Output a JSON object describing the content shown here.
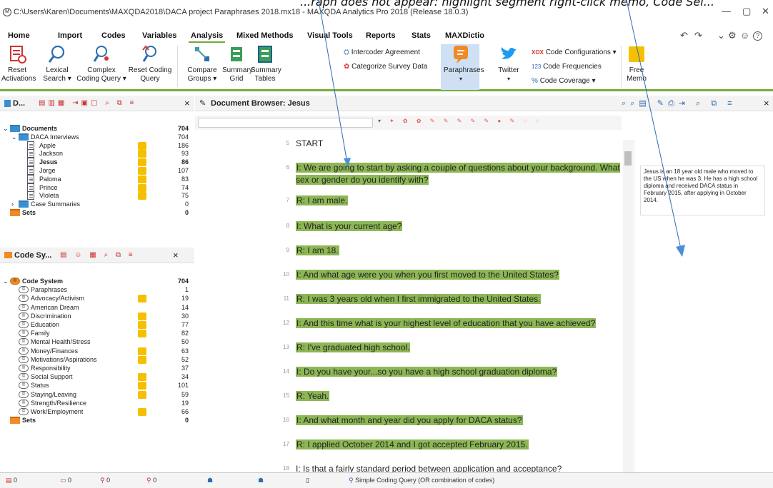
{
  "caption": "...raph does not appear: highlight segment right-click memo, Code Sel...",
  "window": {
    "logo": "M",
    "title": "C:\\Users\\Karen\\Documents\\MAXQDA2018\\DACA project Paraphrases 2018.mx18 - MAXQDA Analytics Pro 2018  (Release 18.0.3)",
    "minimize": "—",
    "maximize": "▢",
    "close": "✕"
  },
  "menu": [
    "Home",
    "Import",
    "Codes",
    "Variables",
    "Analysis",
    "Mixed Methods",
    "Visual Tools",
    "Reports",
    "Stats",
    "MAXDictio"
  ],
  "menu_right": {
    "undo": "↶",
    "redo": "↷",
    "chevron": "⌄",
    "gear": "⚙",
    "smile": "☺",
    "help": "?"
  },
  "ribbon": {
    "reset_activations": "Reset Activations",
    "lexical_search": "Lexical Search ▾",
    "complex_coding": "Complex Coding Query ▾",
    "reset_coding": "Reset Coding Query",
    "compare_groups": "Compare Groups ▾",
    "summary_grid": "Summary Grid",
    "summary_tables": "Summary Tables",
    "intercoder": "Intercoder Agreement",
    "categorize": "Categorize Survey Data",
    "paraphrases": "Paraphrases",
    "twitter": "Twitter",
    "code_configurations": "Code Configurations ▾",
    "code_frequencies": "Code Frequencies",
    "code_coverage": "Code Coverage ▾",
    "free_memo": "Free Memo"
  },
  "documents": {
    "panel_title": "D...",
    "items": [
      {
        "label": "Documents",
        "count": "704",
        "bold": true,
        "level": 0
      },
      {
        "label": "DACA Interviews",
        "count": "704",
        "bold": false,
        "level": 1
      },
      {
        "label": "Apple",
        "count": "186",
        "bold": false,
        "level": 2,
        "tag": true
      },
      {
        "label": "Jackson",
        "count": "93",
        "bold": false,
        "level": 2,
        "tag": true
      },
      {
        "label": "Jesus",
        "count": "86",
        "bold": true,
        "level": 2,
        "tag": true
      },
      {
        "label": "Jorge",
        "count": "107",
        "bold": false,
        "level": 2,
        "tag": true
      },
      {
        "label": "Paloma",
        "count": "83",
        "bold": false,
        "level": 2,
        "tag": true
      },
      {
        "label": "Prince",
        "count": "74",
        "bold": false,
        "level": 2,
        "tag": true
      },
      {
        "label": "Violeta",
        "count": "75",
        "bold": false,
        "level": 2,
        "tag": true
      },
      {
        "label": "Case Summaries",
        "count": "0",
        "bold": false,
        "level": 1
      },
      {
        "label": "Sets",
        "count": "0",
        "bold": true,
        "level": 0
      }
    ]
  },
  "codes": {
    "panel_title": "Code Sy...",
    "items": [
      {
        "label": "Code System",
        "count": "704",
        "bold": true,
        "level": 0
      },
      {
        "label": "Paraphrases",
        "count": "1",
        "level": 1
      },
      {
        "label": "Advocacy/Activism",
        "count": "19",
        "level": 1,
        "tag": true
      },
      {
        "label": "American Dream",
        "count": "14",
        "level": 1
      },
      {
        "label": "Discrimination",
        "count": "30",
        "level": 1,
        "tag": true
      },
      {
        "label": "Education",
        "count": "77",
        "level": 1,
        "tag": true
      },
      {
        "label": "Family",
        "count": "82",
        "level": 1,
        "tag": true
      },
      {
        "label": "Mental Health/Stress",
        "count": "50",
        "level": 1
      },
      {
        "label": "Money/Finances",
        "count": "63",
        "level": 1,
        "tag": true
      },
      {
        "label": "Motivations/Aspirations",
        "count": "52",
        "level": 1,
        "tag": true
      },
      {
        "label": "Responsibility",
        "count": "37",
        "level": 1
      },
      {
        "label": "Social Support",
        "count": "34",
        "level": 1,
        "tag": true
      },
      {
        "label": "Status",
        "count": "101",
        "level": 1,
        "tag": true
      },
      {
        "label": "Staying/Leaving",
        "count": "59",
        "level": 1,
        "tag": true
      },
      {
        "label": "Strength/Resilience",
        "count": "19",
        "level": 1
      },
      {
        "label": "Work/Employment",
        "count": "66",
        "level": 1,
        "tag": true
      },
      {
        "label": "Sets",
        "count": "0",
        "bold": true,
        "level": 0
      }
    ]
  },
  "browser": {
    "title": "Document Browser: Jesus",
    "paragraphs": [
      {
        "n": "5",
        "text": "START",
        "hl": false
      },
      {
        "n": "6",
        "text": "I: We are going to start by asking a couple of questions about your background. What sex or gender do you identify with?",
        "hl": true
      },
      {
        "n": "7",
        "text": "R: I am male.",
        "hl": true
      },
      {
        "n": "8",
        "text": "I: What is your current age?",
        "hl": true
      },
      {
        "n": "9",
        "text": "R: I am 18.",
        "hl": true
      },
      {
        "n": "10",
        "text": "I: And what age were you when you first moved to the United States?",
        "hl": true
      },
      {
        "n": "11",
        "text": "R: I was 3 years old when I first immigrated to the United States.",
        "hl": true
      },
      {
        "n": "12",
        "text": "I: And this time what is your highest level of education that you have achieved?",
        "hl": true
      },
      {
        "n": "13",
        "text": "R: I've graduated high school.",
        "hl": true
      },
      {
        "n": "14",
        "text": "I: Do you have your...so you have a high school graduation diploma?",
        "hl": true
      },
      {
        "n": "15",
        "text": "R: Yeah.",
        "hl": true
      },
      {
        "n": "16",
        "text": "I: And what month and year did you apply for DACA status?",
        "hl": true
      },
      {
        "n": "17",
        "text": "R: I applied October 2014 and I got accepted February 2015.",
        "hl": true
      },
      {
        "n": "18",
        "text": "I: Is that a fairly standard period between application and acceptance?",
        "hl": false
      }
    ]
  },
  "memo": "Jesus is an 18 year old male who moved to the US when he was 3. He has a high school diploma and received DACA status in February 2015, after applying in October 2014.",
  "status": [
    "0",
    "0",
    "0",
    "0",
    "",
    "",
    "",
    "Simple Coding Query (OR combination of codes)"
  ],
  "colors": {
    "accent": "#75ad3c",
    "highlight": "#8db755",
    "tag": "#f5c000",
    "folder": "#3a8fd0"
  }
}
